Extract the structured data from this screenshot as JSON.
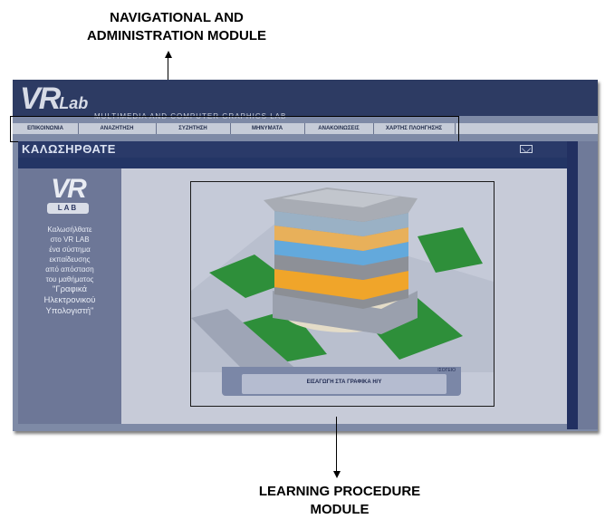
{
  "annotations": {
    "top_line1": "NAVIGATIONAL AND",
    "top_line2": "ADMINISTRATION MODULE",
    "bottom_line1": "LEARNING PROCEDURE",
    "bottom_line2": "MODULE"
  },
  "header": {
    "logo_main": "VR",
    "logo_small": "Lab",
    "subtitle": "MULTIMEDIA AND COMPUTER GRAPHICS LAB"
  },
  "nav": {
    "items": [
      {
        "label": "ΕΠΙΚΟΙΝΩΝΙΑ"
      },
      {
        "label": "ΑΝΑΖΗΤΗΣΗ"
      },
      {
        "label": "ΣΥΖΗΤΗΣΗ"
      },
      {
        "label": "ΜΗΝΥΜΑΤΑ"
      },
      {
        "label": "ΑΝΑΚΟΙΝΩΣΕΙΣ"
      },
      {
        "label": "ΧΑΡΤΗΣ ΠΛΟΗΓΗΣΗΣ"
      }
    ]
  },
  "welcome": {
    "title": "ΚΑΛΩΣΗΡΘΑΤΕ",
    "mail_icon": "mail-icon"
  },
  "sidebar": {
    "logo_main": "VR",
    "logo_sub": "LAB",
    "text_lines": [
      "Καλωσήλθατε",
      "στο VR LAB",
      "ένα σύστημα",
      "εκπαίδευσης",
      "από απόσταση",
      "του μαθήματος"
    ],
    "course_lines": [
      "\"Γραφικά",
      "Ηλεκτρονικού",
      "Υπολογιστή\""
    ]
  },
  "content": {
    "caption_label": "ΙΣΟΓΕΙΟ",
    "caption": "ΕΙΣΑΓΩΓΗ ΣΤΑ ΓΡΑΦΙΚΑ Η/Υ"
  },
  "colors": {
    "header_bg": "#2d3b63",
    "nav_bg": "#c6ccd8",
    "content_bg": "#c7cbd8",
    "sidebar_bg": "#6d7797"
  }
}
